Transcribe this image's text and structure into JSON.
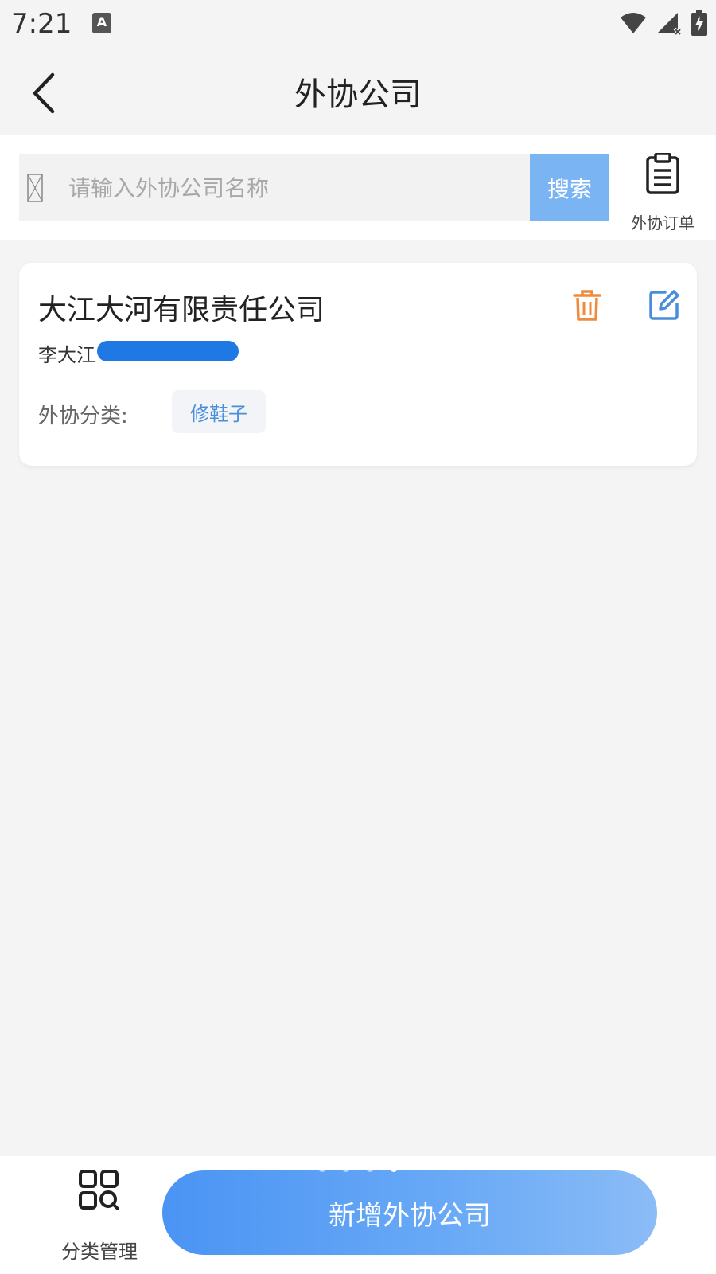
{
  "status_bar": {
    "time": "7:21",
    "keyboard_badge": "A"
  },
  "header": {
    "title": "外协公司"
  },
  "search": {
    "placeholder": "请输入外协公司名称",
    "value": "",
    "button_label": "搜索"
  },
  "orders_button": {
    "label": "外协订单"
  },
  "companies": [
    {
      "name": "大江大河有限责任公司",
      "contact_name": "李大江",
      "category_label": "外协分类:",
      "category_tag": "修鞋子"
    }
  ],
  "bottom_bar": {
    "category_manage_label": "分类管理",
    "add_button_label": "新增外协公司"
  },
  "colors": {
    "accent_blue": "#4a94f4",
    "search_button": "#7ab4f3",
    "delete_orange": "#f08a3c",
    "edit_blue": "#4a8ed9"
  }
}
